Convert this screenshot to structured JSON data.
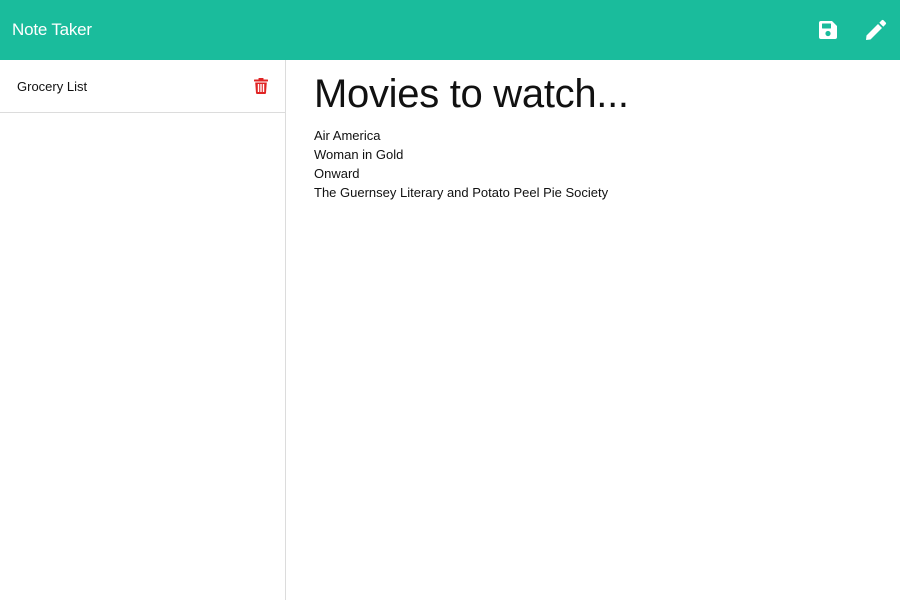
{
  "colors": {
    "navbar_bg": "#1abc9c",
    "delete_icon": "#e02424",
    "nav_icon": "#ffffff",
    "divider": "#dcdcdc"
  },
  "navbar": {
    "title": "Note Taker",
    "icons": {
      "save": "floppy-disk-icon",
      "new": "pencil-icon"
    }
  },
  "sidebar": {
    "items": [
      {
        "title": "Grocery List",
        "delete_icon": "trash-icon"
      }
    ]
  },
  "note": {
    "title": "Movies to watch...",
    "lines": [
      "Air America",
      "Woman in Gold",
      "Onward",
      "The Guernsey Literary and Potato Peel Pie Society"
    ]
  }
}
